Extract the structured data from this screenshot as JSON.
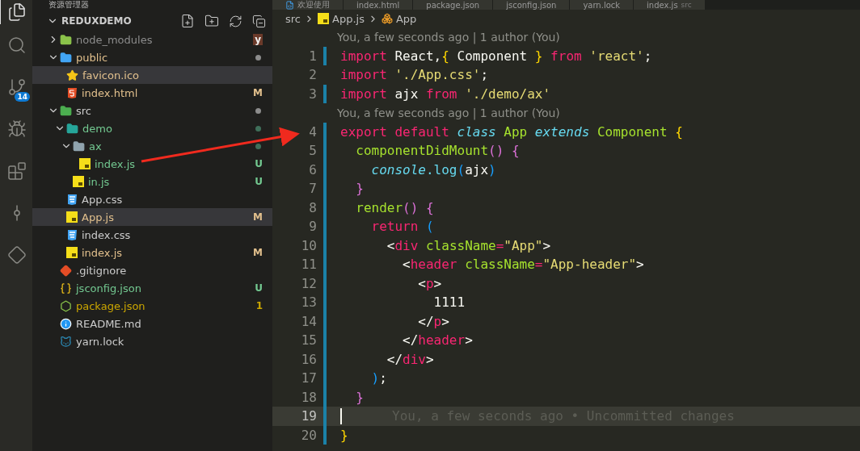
{
  "top_tabs": [
    {
      "label": "欢迎使用",
      "kind": "welcome",
      "selected": false
    },
    {
      "label": "index.html",
      "kind": "html",
      "selected": false
    },
    {
      "label": "package.json",
      "kind": "npm",
      "selected": false
    },
    {
      "label": "jsconfig.json",
      "kind": "json",
      "selected": false
    },
    {
      "label": "yarn.lock",
      "kind": "yarn",
      "selected": false
    },
    {
      "label": "index.js",
      "hint": "src",
      "kind": "js",
      "selected": false
    }
  ],
  "activity_bar": [
    {
      "kind": "files",
      "selected": true
    },
    {
      "kind": "search",
      "selected": false
    },
    {
      "kind": "scm",
      "selected": false,
      "badge": "14"
    },
    {
      "kind": "debug",
      "selected": false
    },
    {
      "kind": "extensions",
      "selected": false
    },
    {
      "kind": "graph",
      "selected": false
    },
    {
      "kind": "remote",
      "selected": false
    }
  ],
  "sidebar": {
    "title": "资源管理器",
    "project": "REDUXDEMO",
    "items": [
      {
        "name": "node_modules",
        "kind": "folder-node",
        "expanded": false,
        "color": "#8c8c8c",
        "badge": "y",
        "selected": false
      },
      {
        "name": "public",
        "kind": "folder-public",
        "expanded": true,
        "color": "#e2c08d",
        "dot": true,
        "selected": false,
        "children": [
          {
            "name": "favicon.ico",
            "kind": "star",
            "color": "#e2c08d",
            "selected": true
          },
          {
            "name": "index.html",
            "kind": "html",
            "color": "#e2c08d",
            "badge": "M",
            "selected": false
          }
        ]
      },
      {
        "name": "src",
        "kind": "folder-src",
        "expanded": true,
        "color": "#cccccc",
        "dot": true,
        "selected": false,
        "children": [
          {
            "name": "demo",
            "kind": "folder-demo",
            "expanded": true,
            "color": "#73c991",
            "dot": true,
            "selected": false,
            "children": [
              {
                "name": "ax",
                "kind": "folder",
                "expanded": true,
                "color": "#73c991",
                "dot": true,
                "selected": false,
                "children": [
                  {
                    "name": "index.js",
                    "kind": "js",
                    "color": "#73c991",
                    "badge": "U",
                    "selected": false
                  }
                ]
              },
              {
                "name": "in.js",
                "kind": "js",
                "color": "#73c991",
                "badge": "U",
                "selected": false
              }
            ]
          },
          {
            "name": "App.css",
            "kind": "css",
            "color": "#cccccc",
            "selected": false
          },
          {
            "name": "App.js",
            "kind": "js",
            "color": "#e2c08d",
            "badge": "M",
            "selected": true
          },
          {
            "name": "index.css",
            "kind": "css",
            "color": "#cccccc",
            "selected": false
          },
          {
            "name": "index.js",
            "kind": "js",
            "color": "#e2c08d",
            "badge": "M",
            "selected": false
          }
        ]
      },
      {
        "name": ".gitignore",
        "kind": "git",
        "color": "#cccccc",
        "selected": false
      },
      {
        "name": "jsconfig.json",
        "kind": "json",
        "color": "#73c991",
        "badge": "U",
        "selected": false
      },
      {
        "name": "package.json",
        "kind": "npm",
        "color": "#cca700",
        "badge": "1",
        "selected": false
      },
      {
        "name": "README.md",
        "kind": "info",
        "color": "#cccccc",
        "selected": false
      },
      {
        "name": "yarn.lock",
        "kind": "yarn",
        "color": "#cccccc",
        "selected": false
      }
    ]
  },
  "breadcrumb": [
    {
      "label": "src",
      "kind": "folder"
    },
    {
      "label": "App.js",
      "kind": "js"
    },
    {
      "label": "App",
      "kind": "class"
    }
  ],
  "code": [
    {
      "kind": "lens",
      "text": "You, a few seconds ago | 1 author (You)"
    },
    {
      "kind": "code",
      "number": "1",
      "changed": true,
      "tokens": [
        {
          "t": "import ",
          "color": "#f92672"
        },
        {
          "t": "React,",
          "color": "#f8f8f2"
        },
        {
          "t": "{",
          "color": "#ffd700"
        },
        {
          "t": " Component ",
          "color": "#f8f8f2"
        },
        {
          "t": "}",
          "color": "#ffd700"
        },
        {
          "t": " from ",
          "color": "#f92672"
        },
        {
          "t": "'react'",
          "color": "#e6db74"
        },
        {
          "t": ";",
          "color": "#f8f8f2"
        }
      ]
    },
    {
      "kind": "code",
      "number": "2",
      "changed": false,
      "tokens": [
        {
          "t": "import ",
          "color": "#f92672"
        },
        {
          "t": "'./App.css'",
          "color": "#e6db74"
        },
        {
          "t": ";",
          "color": "#f8f8f2"
        }
      ]
    },
    {
      "kind": "code",
      "number": "3",
      "changed": true,
      "tokens": [
        {
          "t": "import ",
          "color": "#f92672"
        },
        {
          "t": "ajx ",
          "color": "#f8f8f2"
        },
        {
          "t": "from ",
          "color": "#f92672"
        },
        {
          "t": "'./demo/ax'",
          "color": "#e6db74"
        }
      ]
    },
    {
      "kind": "lens",
      "text": "You, a few seconds ago | 1 author (You)"
    },
    {
      "kind": "code",
      "number": "4",
      "changed": true,
      "tokens": [
        {
          "t": "export default ",
          "color": "#f92672"
        },
        {
          "t": "class ",
          "color": "#66d9ef",
          "italic": true
        },
        {
          "t": "App ",
          "color": "#a6e22e"
        },
        {
          "t": "extends ",
          "color": "#66d9ef",
          "italic": true
        },
        {
          "t": "Component ",
          "color": "#a6e22e"
        },
        {
          "t": "{",
          "color": "#ffd700"
        }
      ]
    },
    {
      "kind": "code",
      "number": "5",
      "changed": true,
      "tokens": [
        {
          "t": "  componentDidMount",
          "color": "#a6e22e"
        },
        {
          "t": "() {",
          "color": "#da70d6"
        }
      ]
    },
    {
      "kind": "code",
      "number": "6",
      "changed": true,
      "tokens": [
        {
          "t": "    console",
          "color": "#66d9ef",
          "italic": true
        },
        {
          "t": ".log",
          "color": "#66d9ef"
        },
        {
          "t": "(",
          "color": "#179fff"
        },
        {
          "t": "ajx",
          "color": "#f8f8f2"
        },
        {
          "t": ")",
          "color": "#179fff"
        }
      ]
    },
    {
      "kind": "code",
      "number": "7",
      "changed": true,
      "tokens": [
        {
          "t": "  }",
          "color": "#da70d6"
        }
      ]
    },
    {
      "kind": "code",
      "number": "8",
      "changed": true,
      "tokens": [
        {
          "t": "  render",
          "color": "#a6e22e"
        },
        {
          "t": "() {",
          "color": "#da70d6"
        }
      ]
    },
    {
      "kind": "code",
      "number": "9",
      "changed": true,
      "tokens": [
        {
          "t": "    return ",
          "color": "#f92672"
        },
        {
          "t": "(",
          "color": "#179fff"
        }
      ]
    },
    {
      "kind": "code",
      "number": "10",
      "changed": true,
      "tokens": [
        {
          "t": "      <",
          "color": "#f8f8f2"
        },
        {
          "t": "div",
          "color": "#f92672"
        },
        {
          "t": " className",
          "color": "#a6e22e"
        },
        {
          "t": "=",
          "color": "#f92672"
        },
        {
          "t": "\"App\"",
          "color": "#e6db74"
        },
        {
          "t": ">",
          "color": "#f8f8f2"
        }
      ]
    },
    {
      "kind": "code",
      "number": "11",
      "changed": true,
      "tokens": [
        {
          "t": "        <",
          "color": "#f8f8f2"
        },
        {
          "t": "header",
          "color": "#f92672"
        },
        {
          "t": " className",
          "color": "#a6e22e"
        },
        {
          "t": "=",
          "color": "#f92672"
        },
        {
          "t": "\"App-header\"",
          "color": "#e6db74"
        },
        {
          "t": ">",
          "color": "#f8f8f2"
        }
      ]
    },
    {
      "kind": "code",
      "number": "12",
      "changed": true,
      "tokens": [
        {
          "t": "          <",
          "color": "#f8f8f2"
        },
        {
          "t": "p",
          "color": "#f92672"
        },
        {
          "t": ">",
          "color": "#f8f8f2"
        }
      ]
    },
    {
      "kind": "code",
      "number": "13",
      "changed": true,
      "tokens": [
        {
          "t": "            1111",
          "color": "#f8f8f2"
        }
      ]
    },
    {
      "kind": "code",
      "number": "14",
      "changed": true,
      "tokens": [
        {
          "t": "          </",
          "color": "#f8f8f2"
        },
        {
          "t": "p",
          "color": "#f92672"
        },
        {
          "t": ">",
          "color": "#f8f8f2"
        }
      ]
    },
    {
      "kind": "code",
      "number": "15",
      "changed": true,
      "tokens": [
        {
          "t": "        </",
          "color": "#f8f8f2"
        },
        {
          "t": "header",
          "color": "#f92672"
        },
        {
          "t": ">",
          "color": "#f8f8f2"
        }
      ]
    },
    {
      "kind": "code",
      "number": "16",
      "changed": true,
      "tokens": [
        {
          "t": "      </",
          "color": "#f8f8f2"
        },
        {
          "t": "div",
          "color": "#f92672"
        },
        {
          "t": ">",
          "color": "#f8f8f2"
        }
      ]
    },
    {
      "kind": "code",
      "number": "17",
      "changed": true,
      "tokens": [
        {
          "t": "    )",
          "color": "#179fff"
        },
        {
          "t": ";",
          "color": "#f8f8f2"
        }
      ]
    },
    {
      "kind": "code",
      "number": "18",
      "changed": true,
      "tokens": [
        {
          "t": "  }",
          "color": "#da70d6"
        }
      ]
    },
    {
      "kind": "code",
      "number": "19",
      "changed": true,
      "current": true,
      "blame": "You, a few seconds ago • Uncommitted changes"
    },
    {
      "kind": "code",
      "number": "20",
      "changed": true,
      "tokens": [
        {
          "t": "}",
          "color": "#ffd700"
        }
      ]
    }
  ]
}
